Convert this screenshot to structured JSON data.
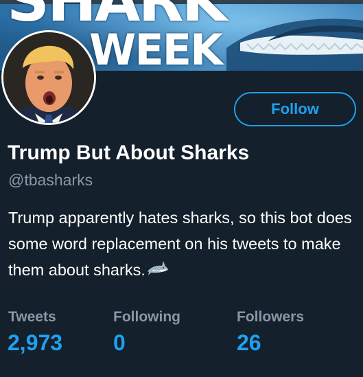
{
  "banner": {
    "title_line_1": "SHARK",
    "title_line_2": "WEEK"
  },
  "profile": {
    "avatar_icon": "profile-avatar",
    "follow_label": "Follow",
    "name": "Trump But About Sharks",
    "handle": "@tbasharks",
    "bio": "Trump apparently hates sharks, so this bot does some word replacement on his tweets to make them about sharks.",
    "bio_emoji": "shark-emoji"
  },
  "stats": [
    {
      "label": "Tweets",
      "value": "2,973"
    },
    {
      "label": "Following",
      "value": "0"
    },
    {
      "label": "Followers",
      "value": "26"
    }
  ],
  "colors": {
    "background": "#14202b",
    "accent": "#1da1f2",
    "secondary_text": "#8899a6"
  }
}
